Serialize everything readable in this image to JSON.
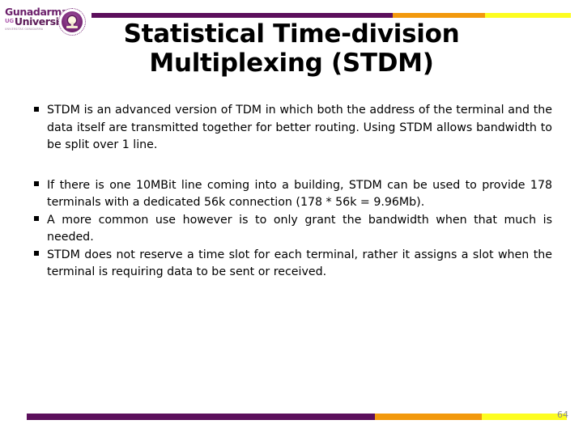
{
  "slide": {
    "title": "Statistical Time-division Multiplexing (STDM)",
    "page_number": "64",
    "accent_colors": {
      "purple": "#5c0f5c",
      "orange": "#f2990d",
      "yellow": "#fdfd20",
      "logo_purple": "#6b1f6b"
    }
  },
  "logo": {
    "name_line1": "Gunadarma",
    "abbrev": "UG",
    "name_line2": "University",
    "tagline": "UNIVERSITAS GUNADARMA",
    "seal_icon": "university-seal-icon"
  },
  "body": {
    "bullet_marker": "square-bullet-icon",
    "bullets": [
      "STDM is an advanced version of TDM in which both the address of the terminal and the data itself are transmitted together for better routing. Using STDM allows bandwidth to be split over 1 line.",
      "If there is one 10MBit line coming into a building, STDM can be used to provide 178 terminals with a dedicated 56k connection (178 * 56k = 9.96Mb).",
      "A more common use however is to only grant the bandwidth when that much is needed.",
      "STDM does not reserve a time slot for each terminal, rather it assigns a slot when the terminal is requiring data to be sent or received."
    ]
  }
}
